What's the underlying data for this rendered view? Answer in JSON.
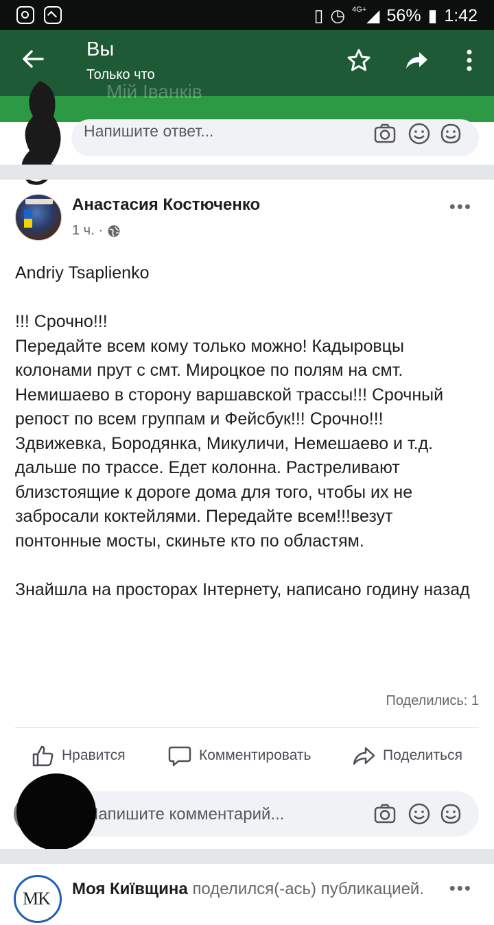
{
  "status_bar": {
    "battery": "56%",
    "time": "1:42",
    "network": "4G+"
  },
  "header": {
    "title": "Вы",
    "subtitle": "Только что",
    "ghost_title": "Мій Іванків"
  },
  "reply": {
    "placeholder": "Напишите ответ..."
  },
  "post": {
    "author": "Анастасия Костюченко",
    "time": "1 ч.",
    "separator": "·",
    "body": [
      "Andriy Tsaplienko",
      "",
      "!!! Срочно!!!",
      "Передайте всем кому только можно! Кадыровцы колонами прут с смт. Мироцкое по полям на смт. Немишаево в сторону варшавской трассы!!! Срочный репост по всем группам и Фейсбук!!! Срочно!!!",
      "Здвижевка, Бородянка, Микуличи, Немешаево и т.д. дальше по трассе. Едет колонна. Растреливают близстоящие к дороге дома для того, чтобы их не забросали коктейлями. Передайте всем!!!везут понтонные мосты, скиньте кто по областям.",
      "",
      "Знайшла на просторах Інтернету, написано годину назад"
    ],
    "shares": "Поделились: 1",
    "actions": {
      "like": "Нравится",
      "comment": "Комментировать",
      "share": "Поделиться"
    }
  },
  "comment": {
    "placeholder": "Напишите комментарий..."
  },
  "next_post": {
    "author": "Моя Київщина",
    "action": "поделился(-ась) публикацией.",
    "avatar_text": "MK"
  },
  "colors": {
    "header_green": "#1e5a35",
    "brand_green": "#2c9a44",
    "text": "#1c1e21",
    "muted": "#65676b"
  }
}
